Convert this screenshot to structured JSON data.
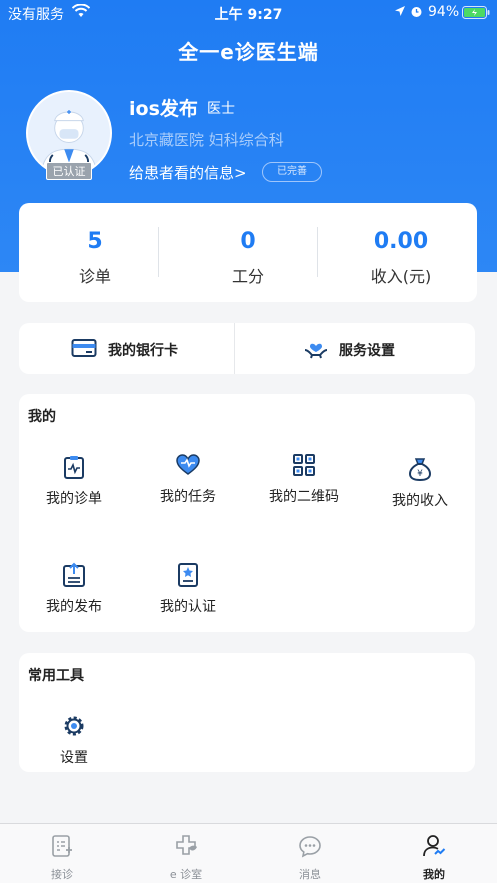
{
  "status_bar": {
    "carrier": "没有服务",
    "time": "上午 9:27",
    "battery_percent": "94%"
  },
  "app": {
    "title": "全一e诊医生端"
  },
  "profile": {
    "name": "ios发布",
    "title": "医士",
    "hospital": "北京藏医院 妇科综合科",
    "verified_badge": "已认证",
    "patient_info_label": "给患者看的信息>",
    "patient_info_status": "已完善"
  },
  "stats": [
    {
      "value": "5",
      "label": "诊单"
    },
    {
      "value": "0",
      "label": "工分"
    },
    {
      "value": "0.00",
      "label": "收入(元)"
    }
  ],
  "quick_actions": [
    {
      "label": "我的银行卡",
      "icon": "bank-card-icon"
    },
    {
      "label": "服务设置",
      "icon": "service-settings-icon"
    }
  ],
  "mine": {
    "title": "我的",
    "items": [
      {
        "label": "我的诊单",
        "icon": "clipboard-icon"
      },
      {
        "label": "我的任务",
        "icon": "heart-task-icon"
      },
      {
        "label": "我的二维码",
        "icon": "qrcode-icon"
      },
      {
        "label": "我的收入",
        "icon": "money-bag-icon"
      },
      {
        "label": "我的发布",
        "icon": "publish-icon"
      },
      {
        "label": "我的认证",
        "icon": "certificate-icon"
      }
    ]
  },
  "tools": {
    "title": "常用工具",
    "items": [
      {
        "label": "设置",
        "icon": "gear-icon"
      }
    ]
  },
  "tabbar": {
    "items": [
      {
        "label": "接诊",
        "icon": "consult-icon",
        "active": false
      },
      {
        "label": "e 诊室",
        "icon": "clinic-icon",
        "active": false
      },
      {
        "label": "消息",
        "icon": "message-icon",
        "active": false
      },
      {
        "label": "我的",
        "icon": "profile-icon",
        "active": true
      }
    ]
  },
  "colors": {
    "primary": "#1f7cf3",
    "page_bg": "#f4f5f7",
    "icon_dark": "#1b3b63",
    "icon_accent": "#3d8bf0"
  }
}
